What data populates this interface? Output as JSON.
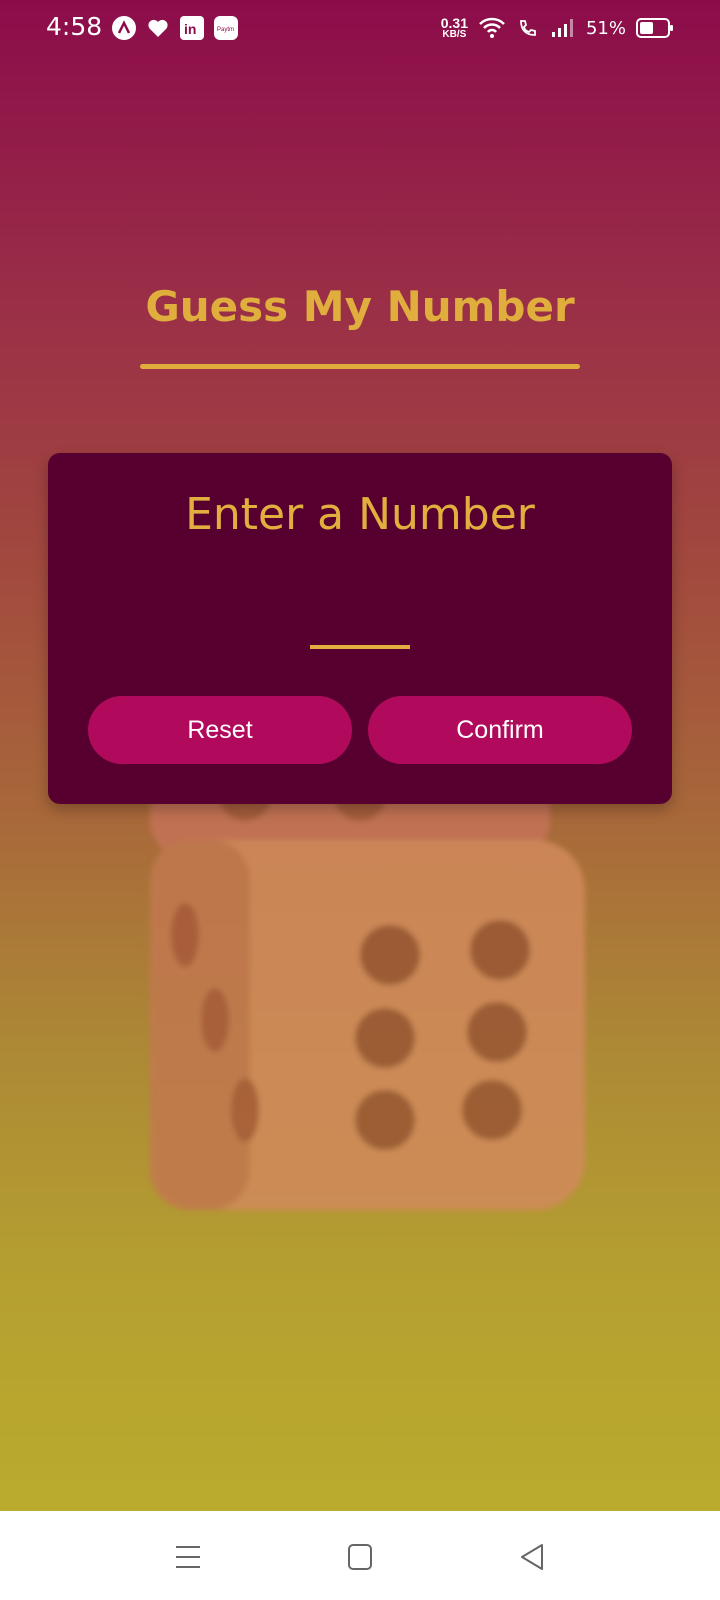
{
  "status_bar": {
    "time": "4:58",
    "net_speed_value": "0.31",
    "net_speed_unit": "KB/S",
    "battery_percent": "51%",
    "battery_level": 0.51,
    "notification_icons": [
      "arc-app-icon",
      "heart-icon",
      "linkedin-icon",
      "paytm-icon"
    ],
    "paytm_label": "Paytm",
    "linkedin_label": "in"
  },
  "app": {
    "title": "Guess My Number",
    "card": {
      "prompt": "Enter a Number",
      "input_value": "",
      "reset_label": "Reset",
      "confirm_label": "Confirm"
    }
  },
  "colors": {
    "accent": "#e0ae3c",
    "card_bg": "#570030",
    "button_bg": "#b10a5c",
    "gradient_top": "#8c0c4a",
    "gradient_bottom": "#baab2e"
  },
  "nav_bar": {
    "icons": [
      "menu-icon",
      "home-square-icon",
      "back-triangle-icon"
    ]
  }
}
